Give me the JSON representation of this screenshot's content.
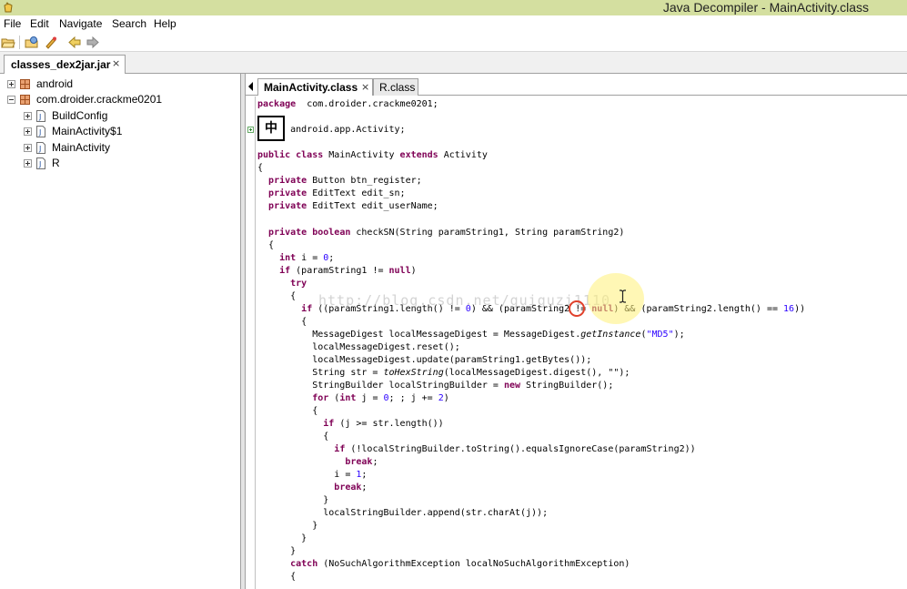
{
  "window": {
    "title": "Java Decompiler - MainActivity.class"
  },
  "menu": {
    "items": [
      "File",
      "Edit",
      "Navigate",
      "Search",
      "Help"
    ]
  },
  "toolbar": {
    "buttons": [
      "open-folder-icon",
      "open-type-icon",
      "quick-launch-icon",
      "back-arrow-icon",
      "forward-arrow-icon"
    ]
  },
  "file_tab": {
    "label": "classes_dex2jar.jar",
    "close": "×"
  },
  "tree": {
    "nodes": [
      {
        "label": "android",
        "kind": "package"
      },
      {
        "label": "com.droider.crackme0201",
        "kind": "package"
      },
      {
        "label": "BuildConfig",
        "kind": "class"
      },
      {
        "label": "MainActivity$1",
        "kind": "class"
      },
      {
        "label": "MainActivity",
        "kind": "class"
      },
      {
        "label": "R",
        "kind": "class"
      }
    ]
  },
  "editor_tabs": [
    {
      "label": "MainActivity.class",
      "close": "×",
      "active": true
    },
    {
      "label": "R.class",
      "active": false
    }
  ],
  "ime": {
    "label": "中"
  },
  "watermark": "http://blog.csdn.net/guiguzi1110",
  "code": [
    [
      [
        "kw",
        "package"
      ],
      [
        "",
        "  com.droider.crackme0201;"
      ]
    ],
    [
      [
        "",
        "      android.app.Activity;"
      ]
    ],
    [
      [
        "kw",
        "public class"
      ],
      [
        "",
        " MainActivity "
      ],
      [
        "kw",
        "extends"
      ],
      [
        "",
        " Activity"
      ]
    ],
    [
      [
        "",
        "{"
      ]
    ],
    [
      [
        "",
        "  "
      ],
      [
        "kw",
        "private"
      ],
      [
        "",
        " Button btn_register;"
      ]
    ],
    [
      [
        "",
        "  "
      ],
      [
        "kw",
        "private"
      ],
      [
        "",
        " EditText edit_sn;"
      ]
    ],
    [
      [
        "",
        "  "
      ],
      [
        "kw",
        "private"
      ],
      [
        "",
        " EditText edit_userName;"
      ]
    ],
    [
      [
        "",
        "  "
      ],
      [
        "kw",
        "private boolean"
      ],
      [
        "",
        " checkSN(String paramString1, String paramString2)"
      ]
    ],
    [
      [
        "",
        "  {"
      ]
    ],
    [
      [
        "",
        "    "
      ],
      [
        "kw",
        "int"
      ],
      [
        "",
        " i = "
      ],
      [
        "str",
        "0"
      ],
      [
        "",
        ";"
      ]
    ],
    [
      [
        "",
        "    "
      ],
      [
        "kw",
        "if"
      ],
      [
        "",
        " (paramString1 != "
      ],
      [
        "kw",
        "null"
      ],
      [
        "",
        ")"
      ]
    ],
    [
      [
        "",
        "      "
      ],
      [
        "kw",
        "try"
      ]
    ],
    [
      [
        "",
        "      {"
      ]
    ],
    [
      [
        "",
        "        "
      ],
      [
        "kw",
        "if"
      ],
      [
        "",
        " ((paramString1.length() != "
      ],
      [
        "str",
        "0"
      ],
      [
        "",
        ") && (paramString2 != "
      ],
      [
        "kw",
        "null"
      ],
      [
        "",
        ") && (paramString2.length() == "
      ],
      [
        "str",
        "16"
      ],
      [
        "",
        "))"
      ]
    ],
    [
      [
        "",
        "        {"
      ]
    ],
    [
      [
        "",
        "          MessageDigest localMessageDigest = MessageDigest."
      ],
      [
        "ital",
        "getInstance"
      ],
      [
        "",
        "("
      ],
      [
        "str",
        "\"MD5\""
      ],
      [
        "",
        ");"
      ]
    ],
    [
      [
        "",
        "          localMessageDigest.reset();"
      ]
    ],
    [
      [
        "",
        "          localMessageDigest.update(paramString1.getBytes());"
      ]
    ],
    [
      [
        "",
        "          String str = "
      ],
      [
        "ital",
        "toHexString"
      ],
      [
        "",
        "(localMessageDigest.digest(), \"\");"
      ]
    ],
    [
      [
        "",
        "          StringBuilder localStringBuilder = "
      ],
      [
        "kw",
        "new"
      ],
      [
        "",
        " StringBuilder();"
      ]
    ],
    [
      [
        "",
        "          "
      ],
      [
        "kw",
        "for"
      ],
      [
        "",
        " ("
      ],
      [
        "kw",
        "int"
      ],
      [
        "",
        " j = "
      ],
      [
        "str",
        "0"
      ],
      [
        "",
        "; ; j += "
      ],
      [
        "str",
        "2"
      ],
      [
        "",
        ")"
      ]
    ],
    [
      [
        "",
        "          {"
      ]
    ],
    [
      [
        "",
        "            "
      ],
      [
        "kw",
        "if"
      ],
      [
        "",
        " (j >= str.length())"
      ]
    ],
    [
      [
        "",
        "            {"
      ]
    ],
    [
      [
        "",
        "              "
      ],
      [
        "kw",
        "if"
      ],
      [
        "",
        " (!localStringBuilder.toString().equalsIgnoreCase(paramString2))"
      ]
    ],
    [
      [
        "",
        "                "
      ],
      [
        "kw",
        "break"
      ],
      [
        "",
        ";"
      ]
    ],
    [
      [
        "",
        "              i = "
      ],
      [
        "str",
        "1"
      ],
      [
        "",
        ";"
      ]
    ],
    [
      [
        "",
        "              "
      ],
      [
        "kw",
        "break"
      ],
      [
        "",
        ";"
      ]
    ],
    [
      [
        "",
        "            }"
      ]
    ],
    [
      [
        "",
        "            localStringBuilder.append(str.charAt(j));"
      ]
    ],
    [
      [
        "",
        "          }"
      ]
    ],
    [
      [
        "",
        "        }"
      ]
    ],
    [
      [
        "",
        "      }"
      ]
    ],
    [
      [
        "",
        "      "
      ],
      [
        "kw",
        "catch"
      ],
      [
        "",
        " (NoSuchAlgorithmException localNoSuchAlgorithmException)"
      ]
    ],
    [
      [
        "",
        "      {"
      ]
    ]
  ]
}
